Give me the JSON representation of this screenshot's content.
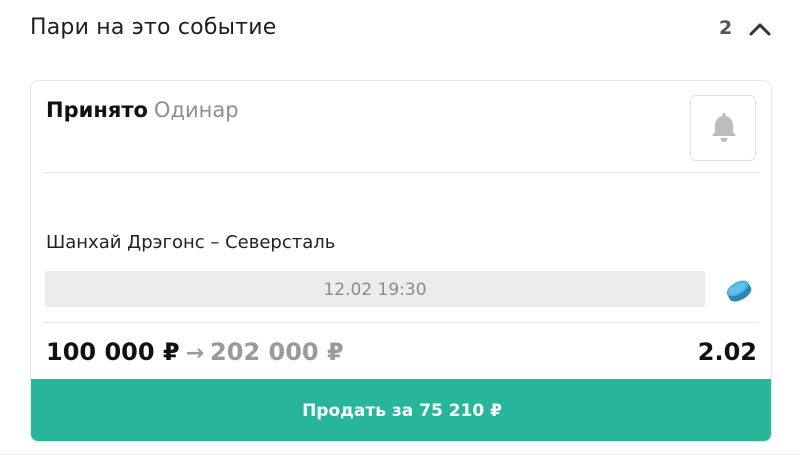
{
  "section": {
    "title": "Пари на это событие",
    "count": "2",
    "collapse_icon": "chevron-up-icon"
  },
  "bet": {
    "status": "Принято",
    "type": "Одинар",
    "bell_icon": "bell-icon",
    "event": "Шанхай Дрэгонс – Северсталь",
    "datetime": "12.02 19:30",
    "sport_icon": "hockey-puck-icon",
    "stake": "100 000 ₽",
    "arrow": "→",
    "payout": "202 000 ₽",
    "odds": "2.02",
    "sell_label": "Продать за 75 210 ₽"
  },
  "colors": {
    "accent": "#27b69c",
    "puck": "#3a9fd0",
    "muted_text": "#9a9a9a"
  }
}
